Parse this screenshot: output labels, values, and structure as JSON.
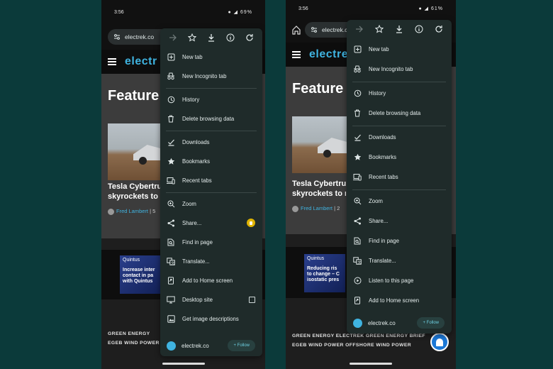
{
  "left": {
    "status": {
      "time": "3:56",
      "battery": "69%"
    },
    "url": "electrek.co",
    "site": {
      "logo": "electr",
      "feature": "Feature",
      "article_title_1": "Tesla Cybertru",
      "article_title_2": "skyrockets to r",
      "author": "Fred Lambert",
      "author_suffix": "| 5"
    },
    "ad": {
      "brand": "Quintus",
      "text": "Increase inter contact in pa with Quintus"
    },
    "tags_line1": "GREEN ENERGY",
    "tags_line2": "EGEB   WIND POWER",
    "menu": {
      "items": [
        {
          "label": "New tab",
          "icon": "plus-box-icon"
        },
        {
          "label": "New Incognito tab",
          "icon": "incognito-icon"
        },
        {
          "label": "History",
          "icon": "history-icon"
        },
        {
          "label": "Delete browsing data",
          "icon": "trash-icon"
        },
        {
          "label": "Downloads",
          "icon": "download-check-icon"
        },
        {
          "label": "Bookmarks",
          "icon": "star-icon"
        },
        {
          "label": "Recent tabs",
          "icon": "devices-icon"
        },
        {
          "label": "Zoom",
          "icon": "zoom-icon"
        },
        {
          "label": "Share...",
          "icon": "share-icon"
        },
        {
          "label": "Find in page",
          "icon": "find-icon"
        },
        {
          "label": "Translate...",
          "icon": "translate-icon"
        },
        {
          "label": "Add to Home screen",
          "icon": "add-home-icon"
        },
        {
          "label": "Desktop site",
          "icon": "desktop-icon"
        },
        {
          "label": "Get image descriptions",
          "icon": "image-icon"
        }
      ],
      "footer_site": "electrek.co",
      "follow": "+ Follow"
    }
  },
  "right": {
    "status": {
      "time": "3:56",
      "battery": "61%"
    },
    "url": "electrek.co",
    "site": {
      "logo": "electre",
      "feature": "Feature",
      "article_title_1": "Tesla Cybertru",
      "article_title_2": "skyrockets to r",
      "author": "Fred Lambert",
      "author_suffix": "| 2"
    },
    "ad": {
      "brand": "Quintus",
      "text": "Reducing ris to change – C isostatic pres"
    },
    "tags_line1": "GREEN ENERGY    ELECTREK GREEN ENERGY BRIEF",
    "tags_line2": "EGEB    WIND POWER    OFFSHORE WIND POWER",
    "menu": {
      "items": [
        {
          "label": "New tab",
          "icon": "plus-box-icon"
        },
        {
          "label": "New Incognito tab",
          "icon": "incognito-icon"
        },
        {
          "label": "History",
          "icon": "history-icon"
        },
        {
          "label": "Delete browsing data",
          "icon": "trash-icon"
        },
        {
          "label": "Downloads",
          "icon": "download-check-icon"
        },
        {
          "label": "Bookmarks",
          "icon": "star-icon"
        },
        {
          "label": "Recent tabs",
          "icon": "devices-icon"
        },
        {
          "label": "Zoom",
          "icon": "zoom-icon"
        },
        {
          "label": "Share...",
          "icon": "share-icon"
        },
        {
          "label": "Find in page",
          "icon": "find-icon"
        },
        {
          "label": "Translate...",
          "icon": "translate-icon"
        },
        {
          "label": "Listen to this page",
          "icon": "play-circle-icon"
        },
        {
          "label": "Add to Home screen",
          "icon": "add-home-icon"
        }
      ],
      "footer_site": "electrek.co",
      "follow": "+ Follow"
    }
  },
  "colors": {
    "background": "#0b3a3a",
    "menu_bg": "#1f2b2a",
    "accent": "#3fb3e0"
  }
}
